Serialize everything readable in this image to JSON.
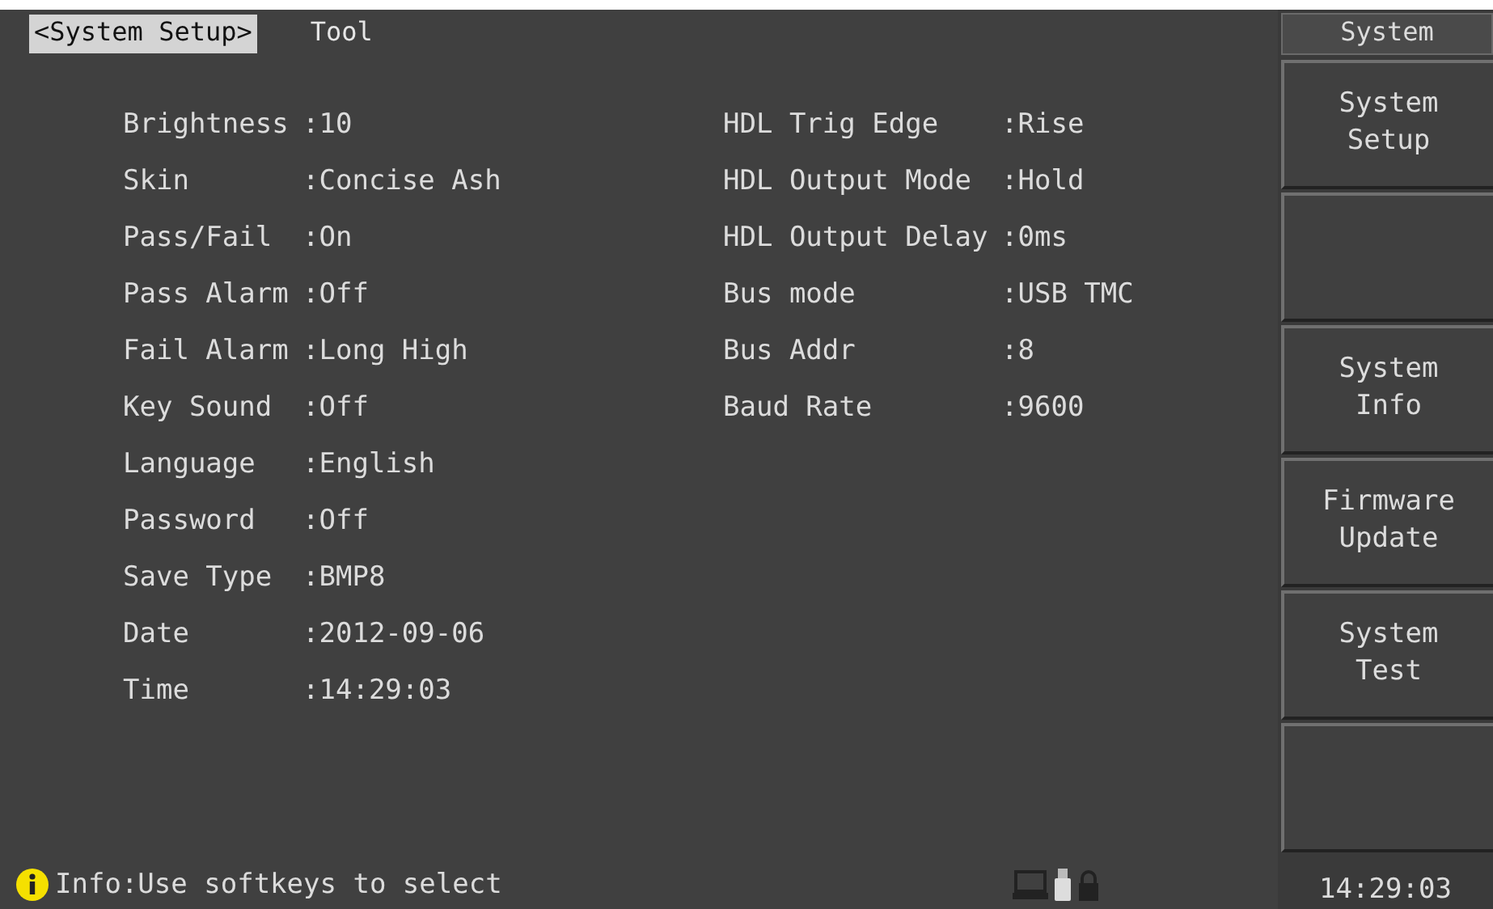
{
  "tabs": [
    {
      "label": "<System Setup>",
      "selected": true
    },
    {
      "label": "Tool",
      "selected": false
    }
  ],
  "left_settings": [
    {
      "label": "Brightness",
      "value": ":10"
    },
    {
      "label": "Skin",
      "value": ":Concise Ash"
    },
    {
      "label": "Pass/Fail",
      "value": ":On"
    },
    {
      "label": "Pass Alarm",
      "value": ":Off"
    },
    {
      "label": "Fail Alarm",
      "value": ":Long High"
    },
    {
      "label": "Key Sound",
      "value": ":Off"
    },
    {
      "label": "Language",
      "value": ":English"
    },
    {
      "label": "Password",
      "value": ":Off"
    },
    {
      "label": "Save Type",
      "value": ":BMP8"
    },
    {
      "label": "Date",
      "value": ":2012-09-06"
    },
    {
      "label": "Time",
      "value": ":14:29:03"
    }
  ],
  "right_settings": [
    {
      "label": "HDL Trig Edge",
      "value": ":Rise"
    },
    {
      "label": "HDL Output Mode",
      "value": ":Hold"
    },
    {
      "label": "HDL Output Delay",
      "value": ":0ms"
    },
    {
      "label": "Bus mode",
      "value": ":USB TMC"
    },
    {
      "label": "Bus Addr",
      "value": ":8"
    },
    {
      "label": "Baud Rate",
      "value": ":9600"
    }
  ],
  "softkeys": {
    "title": "System",
    "buttons": [
      {
        "kind": "label",
        "lines": [
          "System",
          "Setup"
        ]
      },
      {
        "kind": "blank"
      },
      {
        "kind": "label",
        "lines": [
          "System",
          "Info"
        ]
      },
      {
        "kind": "label",
        "lines": [
          "Firmware",
          "Update"
        ]
      },
      {
        "kind": "label",
        "lines": [
          "System",
          "Test"
        ]
      },
      {
        "kind": "blank"
      }
    ],
    "clock": "14:29:03"
  },
  "status_bar": {
    "info": "Info:Use softkeys to select"
  }
}
